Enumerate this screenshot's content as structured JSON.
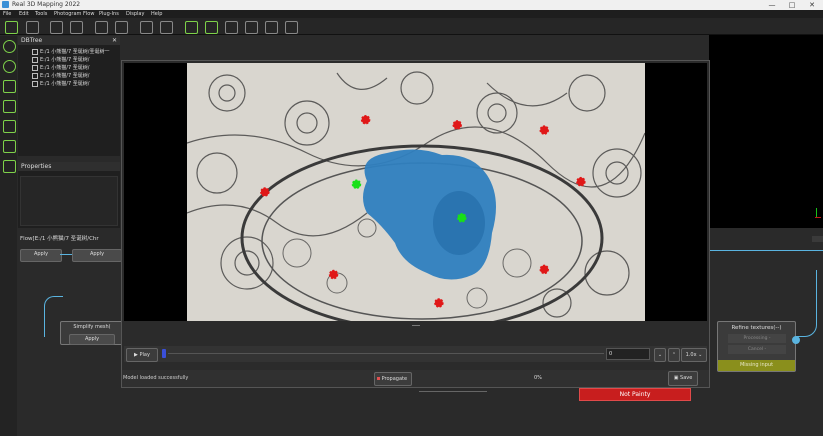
{
  "window": {
    "title": "Real 3D Mapping 2022",
    "controls": [
      "—",
      "□",
      "✕"
    ]
  },
  "menu": [
    "File",
    "Edit",
    "Tools",
    "Photogram",
    "Flow",
    "Plug-Ins",
    "Display",
    "Help"
  ],
  "dbtree": {
    "title": "DBTree",
    "items": [
      "E:/1 小熊猫/7 圣诞树/圣诞树一",
      "E:/1 小熊猫/7 圣诞树/",
      "E:/1 小熊猫/7 圣诞树/",
      "E:/1 小熊猫/7 圣诞树/",
      "E:/1 小熊猫/7 圣诞树/"
    ]
  },
  "properties": {
    "title": "Properties"
  },
  "flow": {
    "label": "Flow[E:/1 小熊猫/7 圣诞树/Chr",
    "apply_left": "Apply",
    "apply_right": "Apply",
    "simplify_title": "Simplify mesh(",
    "simplify_apply": "Apply"
  },
  "refine": {
    "title": "Refine textures(--)",
    "row1": "Processing -",
    "row2": "Cancel -",
    "missing": "Missing input"
  },
  "dialog": {
    "play_label": "Play",
    "frame_value": "0",
    "zoom_label": "1.0x",
    "status_text": "Model loaded successfully",
    "propagate_label": "Propagate",
    "progress_text": "0%",
    "save_label": "Save"
  },
  "not_painty": "Not Painty",
  "colors": {
    "accent_green": "#7ed24a",
    "wire_blue": "#5ab4e0",
    "marker_red": "#e01818",
    "marker_green": "#18e018",
    "mesh_blue": "#2f7fbf",
    "error_red": "#c81e1e"
  },
  "markers": {
    "red": [
      [
        0.39,
        0.22
      ],
      [
        0.59,
        0.24
      ],
      [
        0.78,
        0.26
      ],
      [
        0.17,
        0.5
      ],
      [
        0.86,
        0.46
      ],
      [
        0.32,
        0.82
      ],
      [
        0.78,
        0.8
      ],
      [
        0.55,
        0.93
      ]
    ],
    "green": [
      [
        0.37,
        0.47
      ],
      [
        0.6,
        0.6
      ]
    ]
  }
}
